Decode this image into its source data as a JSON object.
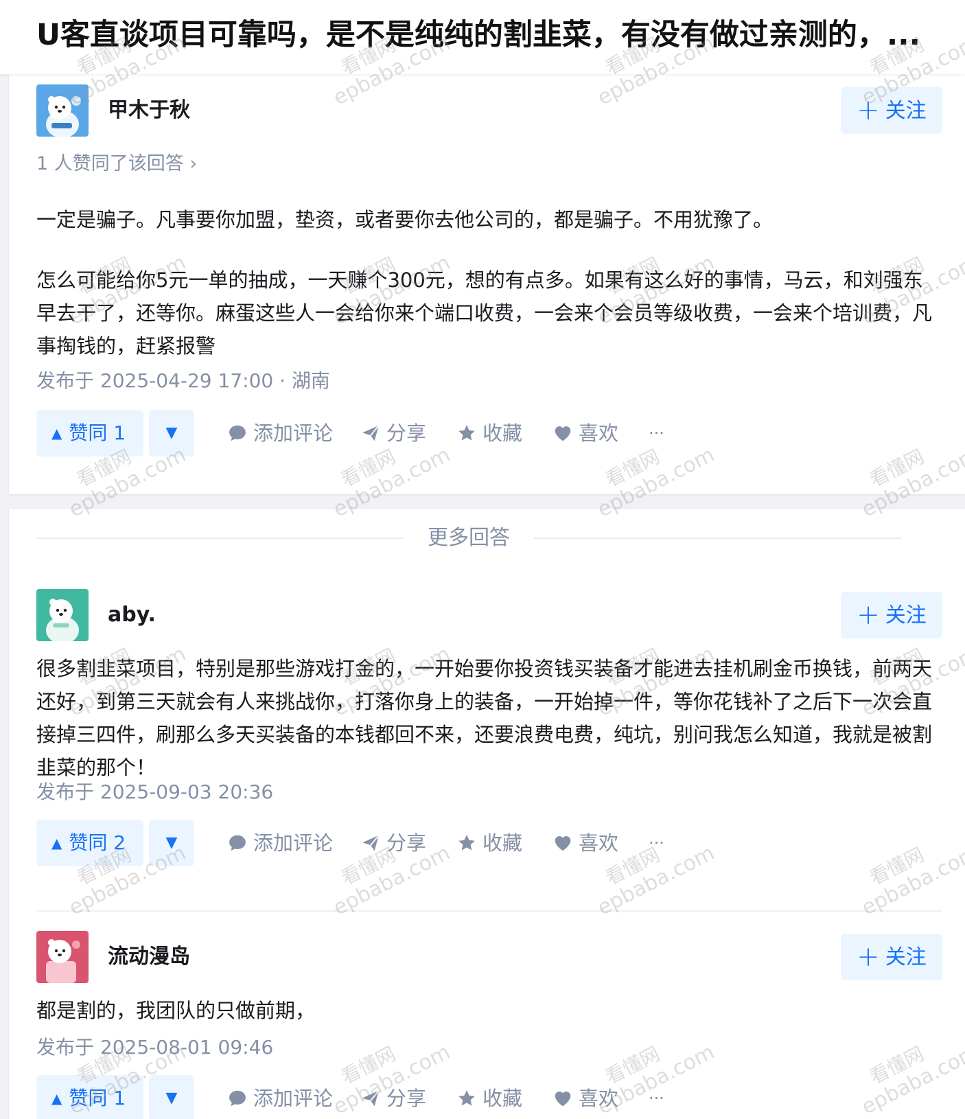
{
  "question": {
    "title": "U客直谈项目可靠吗，是不是纯纯的割韭菜，有没有做过亲测的，..."
  },
  "answers": [
    {
      "author": "甲木于秋",
      "follow_label": "关注",
      "voters_text": "1 人赞同了该回答 ›",
      "paragraphs": [
        "一定是骗子。凡事要你加盟，垫资，或者要你去他公司的，都是骗子。不用犹豫了。",
        "怎么可能给你5元一单的抽成，一天赚个300元，想的有点多。如果有这么好的事情，马云，和刘强东早去干了，还等你。麻蛋这些人一会给你来个端口收费，一会来个会员等级收费，一会来个培训费，凡事掏钱的，赶紧报警"
      ],
      "meta": "发布于 2025-04-29 17:00 · 湖南",
      "avatar_color": "#5aa6e6",
      "vote_label": "赞同 1"
    },
    {
      "author": "aby.",
      "follow_label": "关注",
      "paragraphs": [
        "很多割韭菜项目，特别是那些游戏打金的，一开始要你投资钱买装备才能进去挂机刷金币换钱，前两天还好，到第三天就会有人来挑战你，打落你身上的装备，一开始掉一件，等你花钱补了之后下一次会直接掉三四件，刷那么多天买装备的本钱都回不来，还要浪费电费，纯坑，别问我怎么知道，我就是被割韭菜的那个！"
      ],
      "meta": "发布于 2025-09-03 20:36",
      "avatar_color": "#41b8a0",
      "vote_label": "赞同 2"
    },
    {
      "author": "流动漫岛",
      "follow_label": "关注",
      "paragraphs": [
        "都是割的，我团队的只做前期，"
      ],
      "meta": "发布于 2025-08-01 09:46",
      "avatar_color": "#d9546e",
      "vote_label": "赞同 1"
    }
  ],
  "more_answers_label": "更多回答",
  "actions": {
    "comment": "添加评论",
    "share": "分享",
    "favorite": "收藏",
    "like": "喜欢",
    "more": "···"
  },
  "watermark": {
    "line1": "看懂网",
    "line2": "epbaba.com"
  },
  "colors": {
    "accent": "#1772f6",
    "accent_bg": "#ebf5ff",
    "muted": "#8590a6"
  }
}
